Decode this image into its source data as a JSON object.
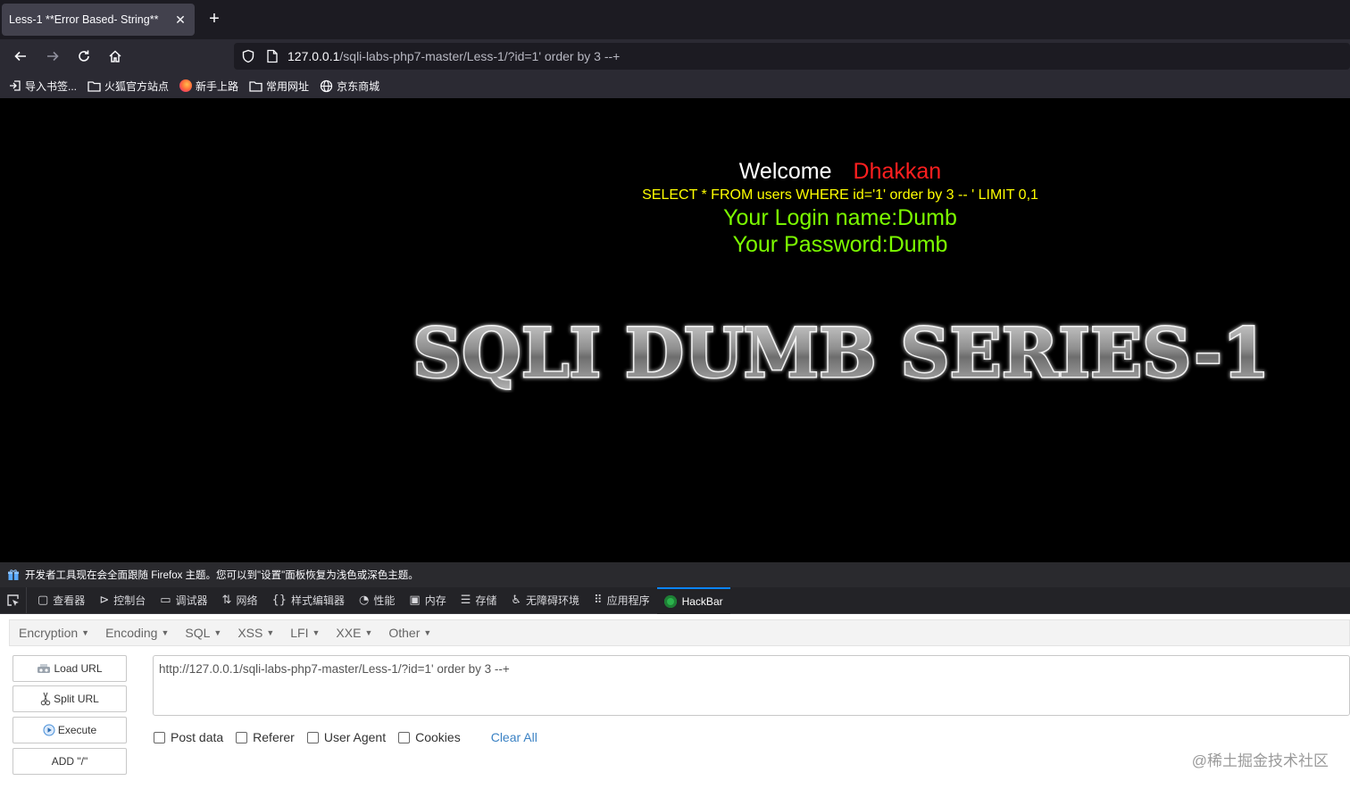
{
  "browser": {
    "tab_title": "Less-1 **Error Based- String**",
    "url_host": "127.0.0.1",
    "url_rest": "/sqli-labs-php7-master/Less-1/?id=1' order by 3 --+",
    "bookmarks": [
      {
        "label": "导入书签...",
        "icon": "import-icon"
      },
      {
        "label": "火狐官方站点",
        "icon": "folder-icon"
      },
      {
        "label": "新手上路",
        "icon": "firefox-icon"
      },
      {
        "label": "常用网址",
        "icon": "folder-icon"
      },
      {
        "label": "京东商城",
        "icon": "globe-icon"
      }
    ]
  },
  "page": {
    "welcome": "Welcome",
    "user": "Dhakkan",
    "query": "SELECT * FROM users WHERE id='1' order by 3 -- ' LIMIT 0,1",
    "login_name": "Your Login name:Dumb",
    "password": "Your Password:Dumb",
    "banner": "SQLI DUMB SERIES-1"
  },
  "devtools": {
    "notice": "开发者工具现在会全面跟随 Firefox 主题。您可以到\"设置\"面板恢复为浅色或深色主题。",
    "tabs": [
      {
        "label": "查看器",
        "icon": "inspector-icon"
      },
      {
        "label": "控制台",
        "icon": "console-icon"
      },
      {
        "label": "调试器",
        "icon": "debugger-icon"
      },
      {
        "label": "网络",
        "icon": "network-icon"
      },
      {
        "label": "样式编辑器",
        "icon": "style-editor-icon"
      },
      {
        "label": "性能",
        "icon": "performance-icon"
      },
      {
        "label": "内存",
        "icon": "memory-icon"
      },
      {
        "label": "存储",
        "icon": "storage-icon"
      },
      {
        "label": "无障碍环境",
        "icon": "accessibility-icon"
      },
      {
        "label": "应用程序",
        "icon": "application-icon"
      },
      {
        "label": "HackBar",
        "icon": "hackbar-icon"
      }
    ]
  },
  "hackbar": {
    "menu": [
      "Encryption",
      "Encoding",
      "SQL",
      "XSS",
      "LFI",
      "XXE",
      "Other"
    ],
    "buttons": {
      "load_url": "Load URL",
      "split_url": "Split URL",
      "execute": "Execute",
      "add_slash": "ADD \"/\""
    },
    "url_value": "http://127.0.0.1/sqli-labs-php7-master/Less-1/?id=1' order by 3 --+",
    "options": [
      "Post data",
      "Referer",
      "User Agent",
      "Cookies"
    ],
    "clear_all": "Clear All"
  },
  "watermark": "@稀土掘金技术社区"
}
